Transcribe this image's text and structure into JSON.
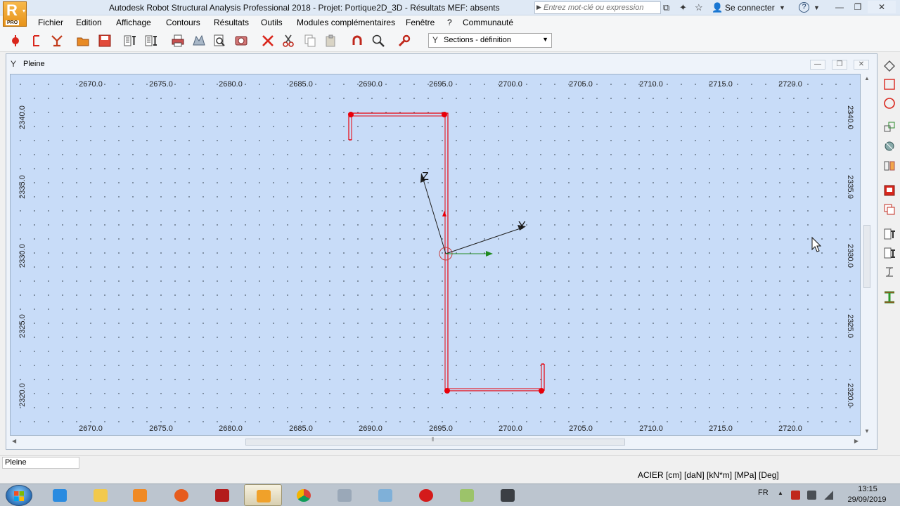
{
  "window": {
    "title": "Autodesk Robot Structural Analysis Professional 2018 - Projet: Portique2D_3D - Résultats MEF: absents",
    "logo_letter": "R",
    "logo_edition": "PRO",
    "search_placeholder": "Entrez mot-clé ou expression",
    "sign_in": "Se connecter",
    "help": "?"
  },
  "menu": [
    "Fichier",
    "Edition",
    "Affichage",
    "Contours",
    "Résultats",
    "Outils",
    "Modules complémentaires",
    "Fenêtre",
    "?",
    "Communauté"
  ],
  "toolbar": {
    "icons": [
      "structure-icon",
      "bar-icon",
      "section-icon",
      "open-icon",
      "save-icon",
      "properties-icon",
      "properties2-icon",
      "print-icon",
      "print-preview-icon",
      "zoom-icon",
      "screen-capture-icon",
      "delete-icon",
      "cut-icon",
      "copy-icon",
      "paste-icon",
      "undo-icon",
      "zoom-window-icon",
      "wrench-icon"
    ],
    "layout_select": "Sections - définition"
  },
  "child_window": {
    "title": "Pleine"
  },
  "grid": {
    "x_ticks": [
      "2670.0",
      "2675.0",
      "2680.0",
      "2685.0",
      "2690.0",
      "2695.0",
      "2700.0",
      "2705.0",
      "2710.0",
      "2715.0",
      "2720.0"
    ],
    "y_ticks": [
      "2340.0",
      "2335.0",
      "2330.0",
      "2325.0",
      "2320.0"
    ]
  },
  "axes": {
    "z_label": "Z",
    "y_label": "Y"
  },
  "colors": {
    "section": "#e8000a",
    "canvas": "#c8dcf8",
    "axis": "#202020",
    "local_axis": "#1f8a1f"
  },
  "right_toolbar": [
    "polyline-icon",
    "rectangle-icon",
    "circle-icon",
    "offset-icon",
    "rotate-icon",
    "mirror-icon",
    "section-db-icon",
    "layers-icon",
    "properties-list-icon",
    "properties-list2-icon",
    "stiffener-icon",
    "steel-section-icon"
  ],
  "status": {
    "view": "Pleine",
    "units": "ACIER   [cm] [daN] [kN*m] [MPa] [Deg]"
  },
  "taskbar": {
    "apps": [
      "internet-explorer-icon",
      "file-explorer-icon",
      "media-player-icon",
      "firefox-icon",
      "autocad-icon",
      "robot-icon",
      "chrome-icon",
      "paint-icon",
      "paint-brush-icon",
      "opera-icon",
      "notepad-icon",
      "tool-icon"
    ],
    "language": "FR",
    "time": "13:15",
    "date": "29/09/2019"
  }
}
